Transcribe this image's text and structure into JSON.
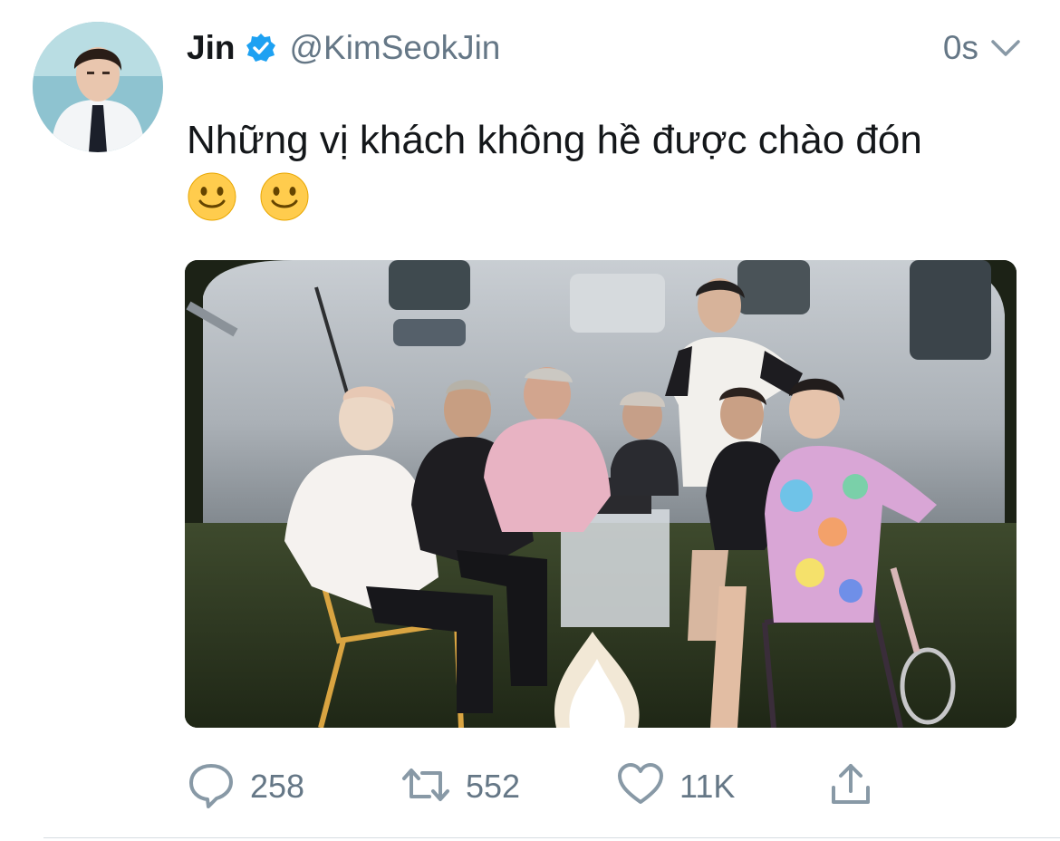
{
  "tweet": {
    "author": {
      "display_name": "Jin",
      "handle": "@KimSeokJin",
      "verified": true
    },
    "timestamp": "0s",
    "text": "Những vị khách không hề được chào đón",
    "emojis": [
      "slightly-smiling-face",
      "slightly-smiling-face"
    ],
    "stats": {
      "replies": "258",
      "retweets": "552",
      "likes": "11K"
    }
  },
  "colors": {
    "text_primary": "#14171a",
    "text_secondary": "#657786",
    "verified_blue": "#1da1f2",
    "divider": "#d7dde2"
  },
  "icons": {
    "verified": "verified-badge-icon",
    "caret": "chevron-down-icon",
    "reply": "reply-icon",
    "retweet": "retweet-icon",
    "like": "heart-icon",
    "share": "share-icon"
  }
}
